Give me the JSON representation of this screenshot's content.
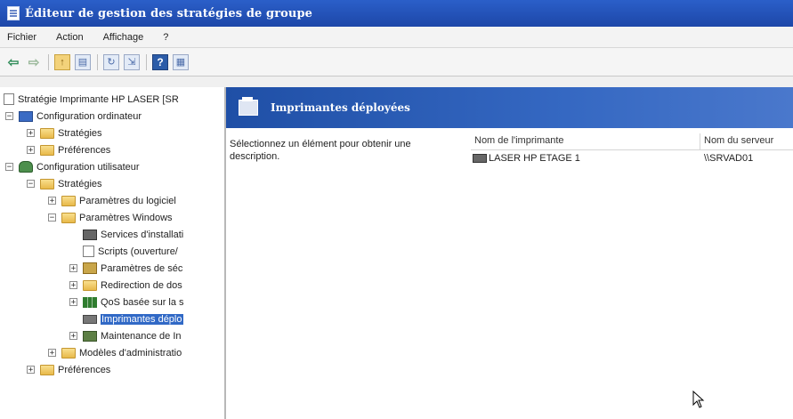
{
  "window": {
    "title": "Éditeur de gestion des stratégies de groupe",
    "icon": "policy-editor-icon"
  },
  "menu": [
    "Fichier",
    "Action",
    "Affichage",
    "?"
  ],
  "toolbar": {
    "buttons": [
      "back-icon",
      "forward-icon",
      "up-folder-icon",
      "show-hide-tree-icon",
      "refresh-icon",
      "export-list-icon",
      "help-icon",
      "properties-icon"
    ]
  },
  "tree": {
    "root": "Stratégie Imprimante HP LASER [SR",
    "items": [
      {
        "label": "Configuration ordinateur",
        "icon": "computer-icon",
        "expander": "−"
      },
      {
        "label": "Stratégies",
        "icon": "folder-icon",
        "expander": "+"
      },
      {
        "label": "Préférences",
        "icon": "folder-icon",
        "expander": "+"
      },
      {
        "label": "Configuration utilisateur",
        "icon": "user-icon",
        "expander": "−"
      },
      {
        "label": "Stratégies",
        "icon": "folder-icon",
        "expander": "−"
      },
      {
        "label": "Paramètres du logiciel",
        "icon": "folder-icon",
        "expander": "+"
      },
      {
        "label": "Paramètres Windows",
        "icon": "folder-icon",
        "expander": "−"
      },
      {
        "label": "Services d'installati",
        "icon": "network-icon",
        "expander": ""
      },
      {
        "label": "Scripts (ouverture/",
        "icon": "script-icon",
        "expander": ""
      },
      {
        "label": "Paramètres de séc",
        "icon": "security-icon",
        "expander": "+"
      },
      {
        "label": "Redirection de dos",
        "icon": "folder-icon",
        "expander": "+"
      },
      {
        "label": "QoS basée sur la s",
        "icon": "chart-icon",
        "expander": "+"
      },
      {
        "label": "Imprimantes déplo",
        "icon": "printer-icon",
        "expander": ""
      },
      {
        "label": "Maintenance de In",
        "icon": "maintenance-icon",
        "expander": "+"
      },
      {
        "label": "Modèles d'administratio",
        "icon": "folder-icon",
        "expander": "+"
      },
      {
        "label": "Préférences",
        "icon": "folder-icon",
        "expander": "+"
      }
    ]
  },
  "details": {
    "header": "Imprimantes déployées",
    "description": "Sélectionnez un élément pour obtenir une description.",
    "columns": [
      "Nom de l'imprimante",
      "Nom du serveur"
    ],
    "rows": [
      {
        "printer": "LASER HP ETAGE 1",
        "server": "\\\\SRVAD01"
      }
    ]
  }
}
